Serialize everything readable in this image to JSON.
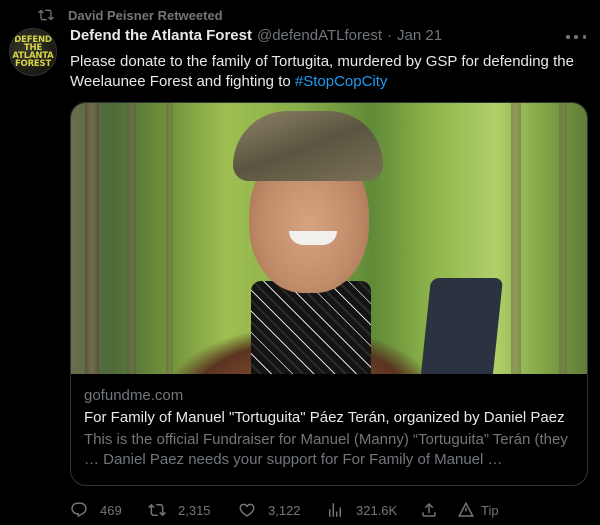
{
  "retweet": {
    "text": "David Peisner Retweeted",
    "icon": "retweet-icon"
  },
  "avatar": {
    "logo_text": "DEFEND THE ATLANTA FOREST",
    "icon": "defend-atlanta-forest-logo"
  },
  "author": {
    "name": "Defend the Atlanta Forest",
    "handle": "@defendATLforest",
    "separator": "·",
    "date": "Jan 21"
  },
  "tweet": {
    "text": "Please donate to the family of Tortugita, murdered by GSP for defending the Weelaunee Forest and fighting to ",
    "hashtag": "#StopCopCity"
  },
  "card": {
    "domain": "gofundme.com",
    "title": "For Family of Manuel \"Tortuguita\" Páez Terán, organized by Daniel Paez",
    "description": "This is the official Fundraiser for Manuel (Manny) “Tortuguita” Terán (they … Daniel Paez needs your support for For Family of Manuel …"
  },
  "actions": {
    "replies": "469",
    "retweets": "2,315",
    "likes": "3,122",
    "views": "321.6K",
    "tip": "Tip"
  },
  "colors": {
    "accent": "#1d9bf0",
    "muted": "#71767b",
    "text": "#e7e9ea",
    "background": "#000000",
    "border": "#2f3336"
  }
}
